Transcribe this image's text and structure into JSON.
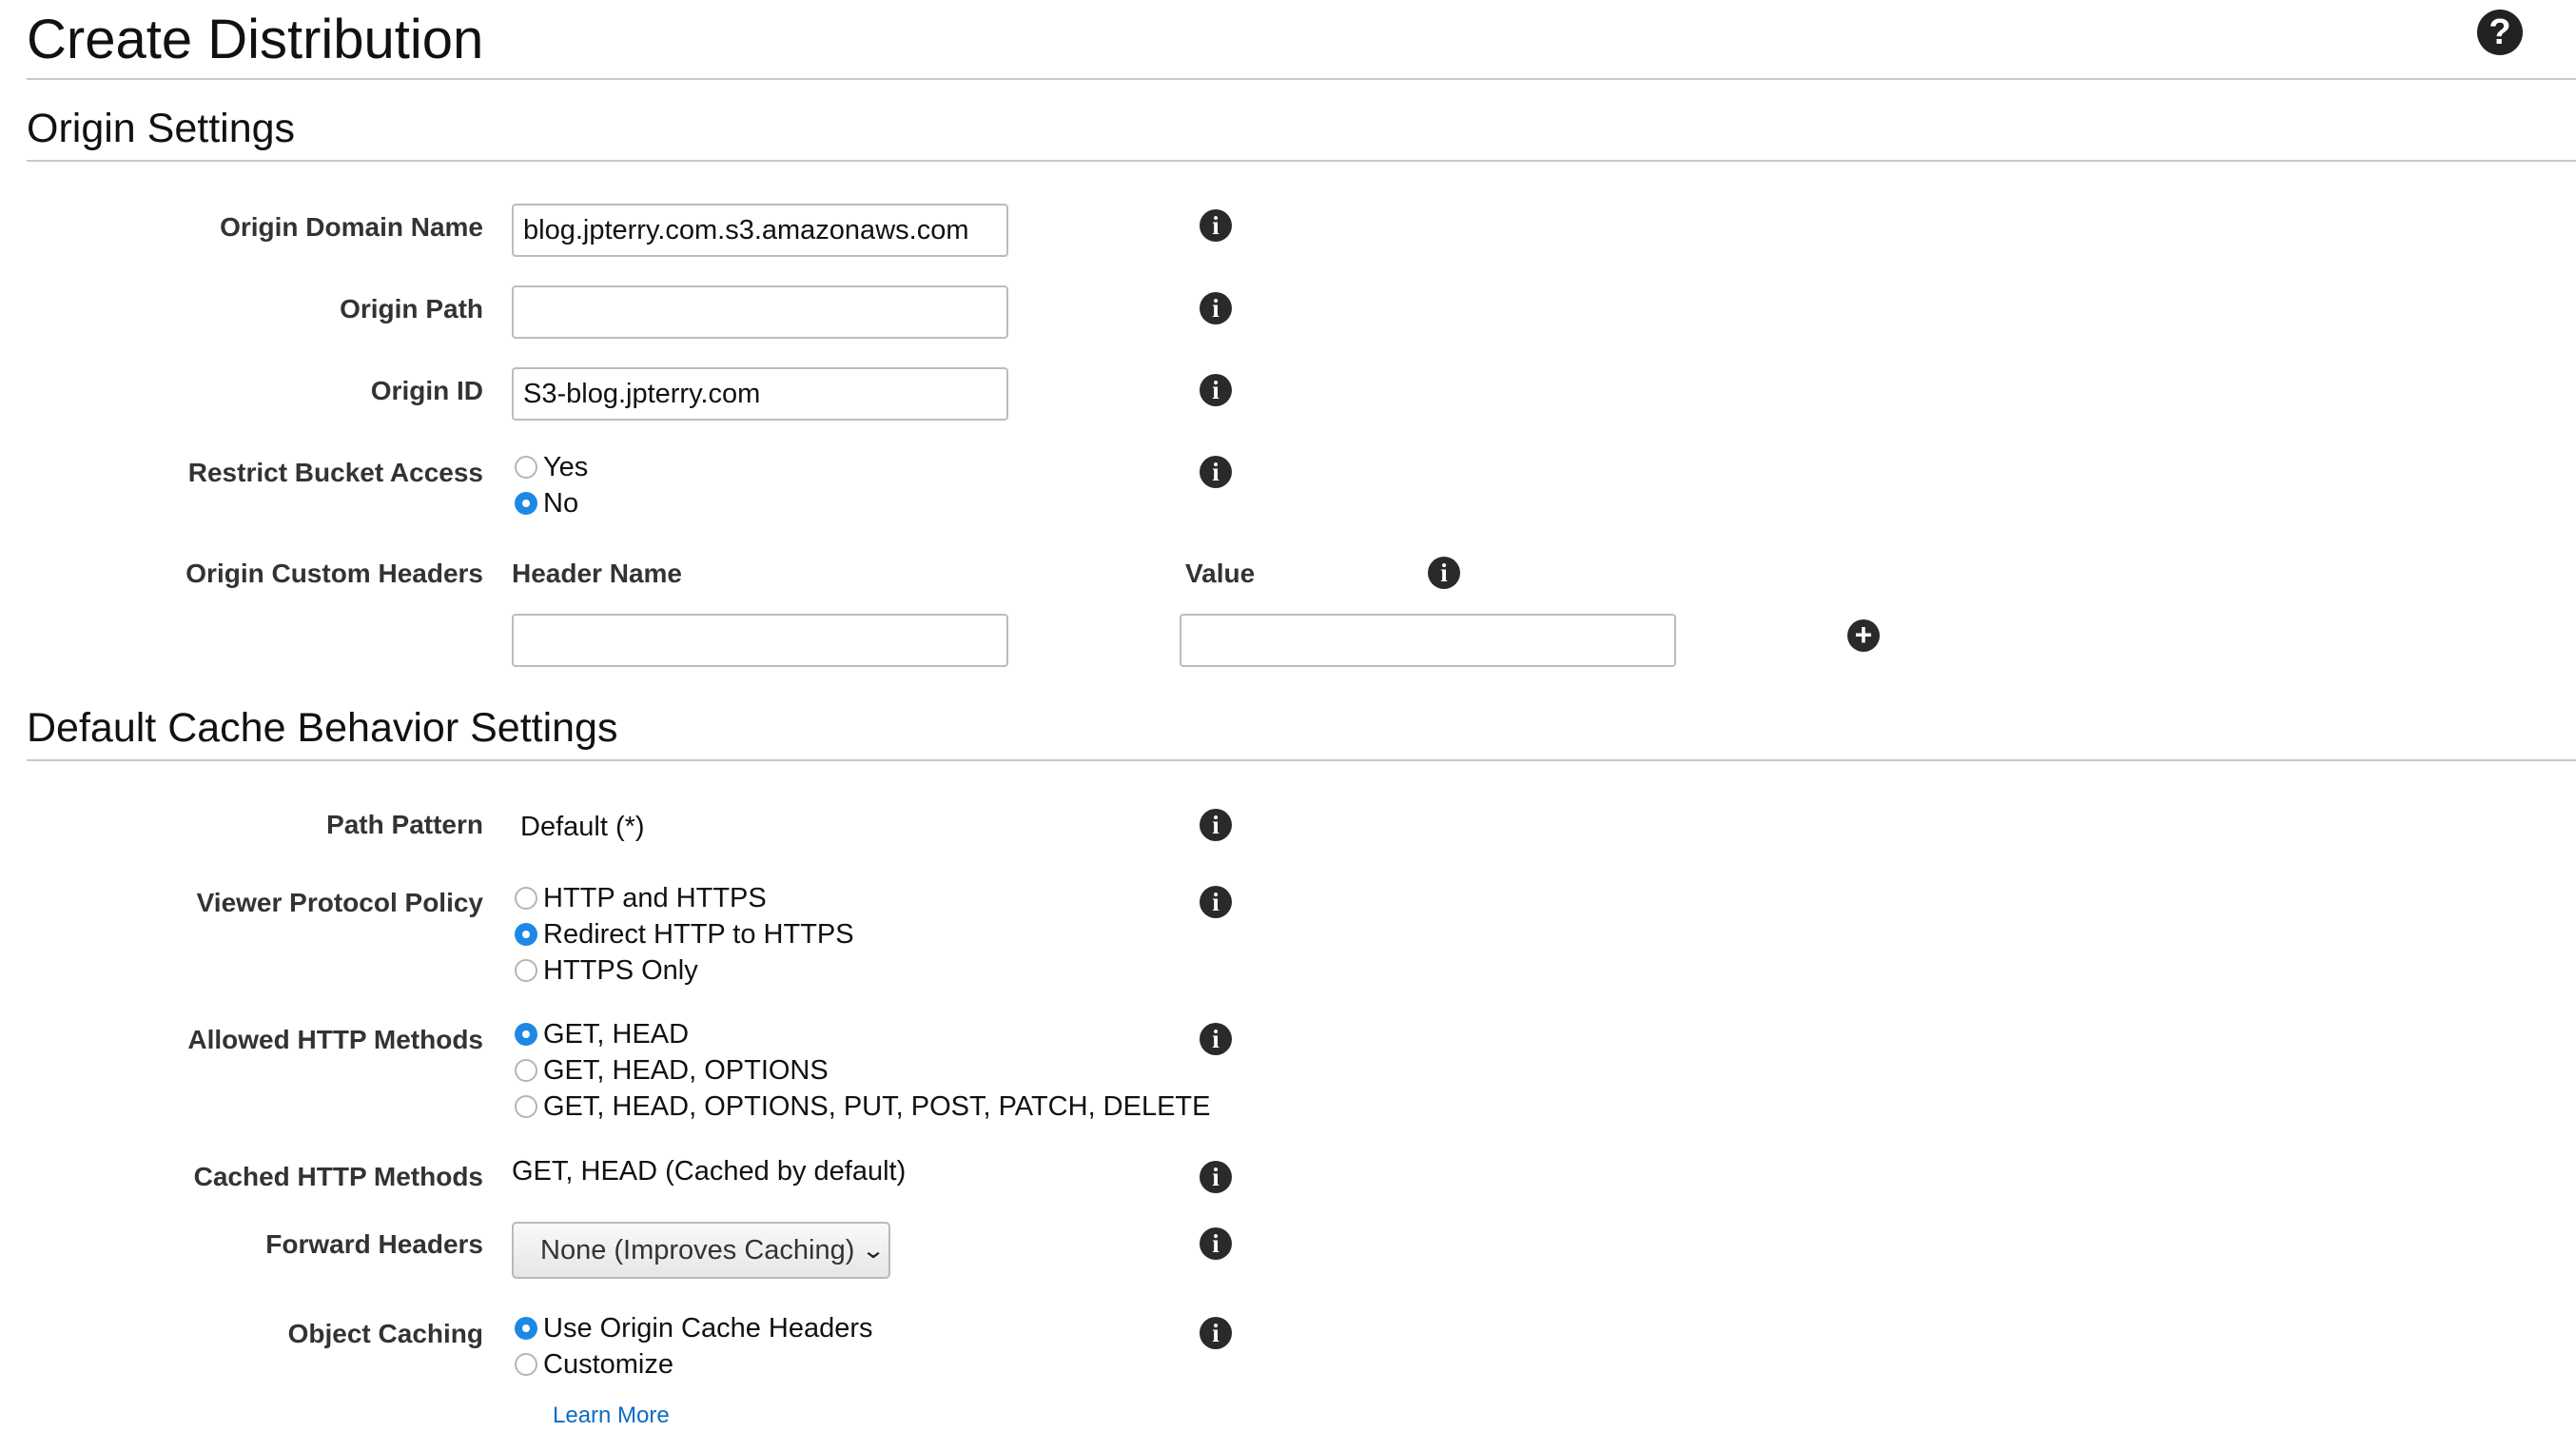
{
  "page": {
    "title": "Create Distribution",
    "help_icon": "question-circle-icon",
    "help_glyph": "?"
  },
  "origin_settings": {
    "heading": "Origin Settings",
    "info_glyph": "i",
    "origin_domain_name": {
      "label": "Origin Domain Name",
      "value": "blog.jpterry.com.s3.amazonaws.com"
    },
    "origin_path": {
      "label": "Origin Path",
      "value": ""
    },
    "origin_id": {
      "label": "Origin ID",
      "value": "S3-blog.jpterry.com"
    },
    "restrict_bucket_access": {
      "label": "Restrict Bucket Access",
      "options": [
        "Yes",
        "No"
      ],
      "selected": "No"
    },
    "custom_headers": {
      "label": "Origin Custom Headers",
      "header_name_heading": "Header Name",
      "value_heading": "Value",
      "header_name_value": "",
      "value_value": "",
      "add_glyph": "+"
    }
  },
  "cache_behavior": {
    "heading": "Default Cache Behavior Settings",
    "path_pattern": {
      "label": "Path Pattern",
      "value": "Default (*)"
    },
    "viewer_protocol_policy": {
      "label": "Viewer Protocol Policy",
      "options": [
        "HTTP and HTTPS",
        "Redirect HTTP to HTTPS",
        "HTTPS Only"
      ],
      "selected": "Redirect HTTP to HTTPS"
    },
    "allowed_http_methods": {
      "label": "Allowed HTTP Methods",
      "options": [
        "GET, HEAD",
        "GET, HEAD, OPTIONS",
        "GET, HEAD, OPTIONS, PUT, POST, PATCH, DELETE"
      ],
      "selected": "GET, HEAD"
    },
    "cached_http_methods": {
      "label": "Cached HTTP Methods",
      "value": "GET, HEAD (Cached by default)"
    },
    "forward_headers": {
      "label": "Forward Headers",
      "selected": "None (Improves Caching)"
    },
    "object_caching": {
      "label": "Object Caching",
      "options": [
        "Use Origin Cache Headers",
        "Customize"
      ],
      "selected": "Use Origin Cache Headers",
      "learn_more": "Learn More"
    }
  },
  "colors": {
    "accent_radio": "#1e88e5",
    "link": "#0b6cc6",
    "rule": "#c9c9c9",
    "label": "#333333"
  }
}
